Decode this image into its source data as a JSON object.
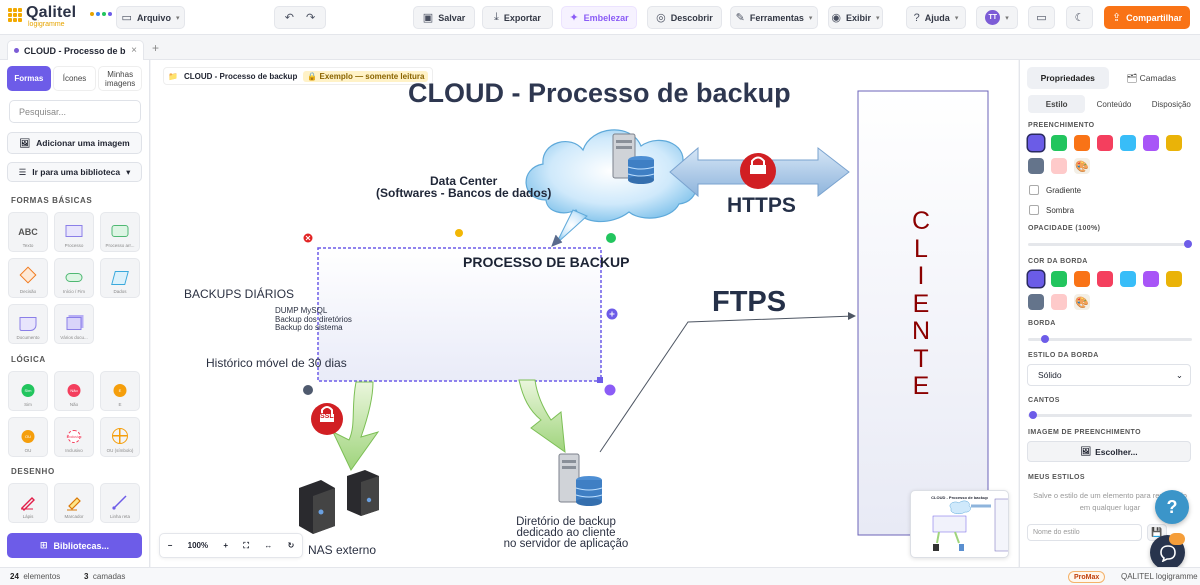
{
  "app": {
    "logo_text": "Qalitel",
    "logo_sub": "logigramme",
    "colors": {
      "accent": "#6d5ce8",
      "share": "#f97316",
      "cliente_text": "#8b0000"
    }
  },
  "toolbar": {
    "arquivo": "Arquivo",
    "salvar": "Salvar",
    "exportar": "Exportar",
    "embelezar": "Embelezar",
    "descobrir": "Descobrir",
    "ferramentas": "Ferramentas",
    "exibir": "Exibir",
    "ajuda": "Ajuda",
    "avatar": "TT",
    "compartilhar": "Compartilhar"
  },
  "tabs": [
    {
      "label": "CLOUD - Processo de b..."
    }
  ],
  "left": {
    "tabs": [
      "Formas",
      "Ícones",
      "Minhas imagens"
    ],
    "search_placeholder": "Pesquisar...",
    "add_image": "Adicionar uma imagem",
    "library_link": "Ir para uma biblioteca",
    "sections": {
      "basic": "FORMAS BÁSICAS",
      "logic": "LÓGICA",
      "drawing": "DESENHO"
    },
    "basic_shapes": [
      {
        "label": "Texto",
        "glyph": "ABC"
      },
      {
        "label": "Processo"
      },
      {
        "label": "Processo arr..."
      },
      {
        "label": "Decisão"
      },
      {
        "label": "Início / Fim"
      },
      {
        "label": "Dados"
      },
      {
        "label": "Documento"
      },
      {
        "label": "Vários docu..."
      }
    ],
    "logic_shapes": [
      {
        "label": "Sim",
        "glyph": "Sim"
      },
      {
        "label": "Não",
        "glyph": "Não"
      },
      {
        "label": "E",
        "glyph": "E"
      },
      {
        "label": "OU",
        "glyph": "OU"
      },
      {
        "label": "Inclusivo",
        "glyph": "Exclusivo"
      },
      {
        "label": "OU (símbolo)"
      }
    ],
    "drawing_shapes": [
      {
        "label": "Lápis"
      },
      {
        "label": "Marcador"
      },
      {
        "label": "Linha reta"
      }
    ],
    "libraries_button": "Bibliotecas..."
  },
  "canvas": {
    "breadcrumb": "CLOUD - Processo de backup",
    "readonly_badge": "Exemplo — somente leitura",
    "title": "CLOUD - Processo de backup",
    "datacenter": [
      "Data Center",
      "(Softwares - Bancos de dados)"
    ],
    "https": "HTTPS",
    "ftps": "FTPS",
    "ssl": "SSL",
    "processo": "PROCESSO DE BACKUP",
    "backups": "BACKUPS DIÁRIOS",
    "dump_lines": [
      "DUMP MySQL",
      "Backup dos diretórios",
      "Backup do sistema"
    ],
    "historico": "Histórico móvel de 30 dias",
    "nas": "NAS externo",
    "diretorio": [
      "Diretório de backup",
      "dedicado ao cliente",
      "no servidor de aplicação"
    ],
    "cliente": [
      "C",
      "L",
      "I",
      "E",
      "N",
      "T",
      "E"
    ],
    "zoom": "100%",
    "minimap_title": "CLOUD - Processo de backup"
  },
  "right": {
    "tabs": [
      "Propriedades",
      "Camadas"
    ],
    "subtabs": [
      "Estilo",
      "Conteúdo",
      "Disposição"
    ],
    "preenchimento": "PREENCHIMENTO",
    "gradiente": "Gradiente",
    "sombra": "Sombra",
    "opacidade": "OPACIDADE (100%)",
    "opacity_value": 1.0,
    "cor_borda": "COR DA BORDA",
    "borda": "BORDA",
    "estilo_borda": "ESTILO DA BORDA",
    "estilo_borda_value": "Sólido",
    "cantos": "CANTOS",
    "imagem": "IMAGEM DE PREENCHIMENTO",
    "escolher": "Escolher...",
    "meus_estilos": "MEUS ESTILOS",
    "hint": "Salve o estilo de um elemento para reutilizá-lo em qualquer lugar",
    "nome_placeholder": "Nome do estilo",
    "palette": [
      "#6b5ce7",
      "#22c55e",
      "#f97316",
      "#f43f5e",
      "#38bdf8",
      "#a855f7",
      "#eab308",
      "#64748b",
      "#fecaca"
    ]
  },
  "status": {
    "elements_count": "24",
    "elements_label": "elementos",
    "layers_count": "3",
    "layers_label": "camadas",
    "plan": "ProMax",
    "brand": "QALITEL logigramme"
  }
}
